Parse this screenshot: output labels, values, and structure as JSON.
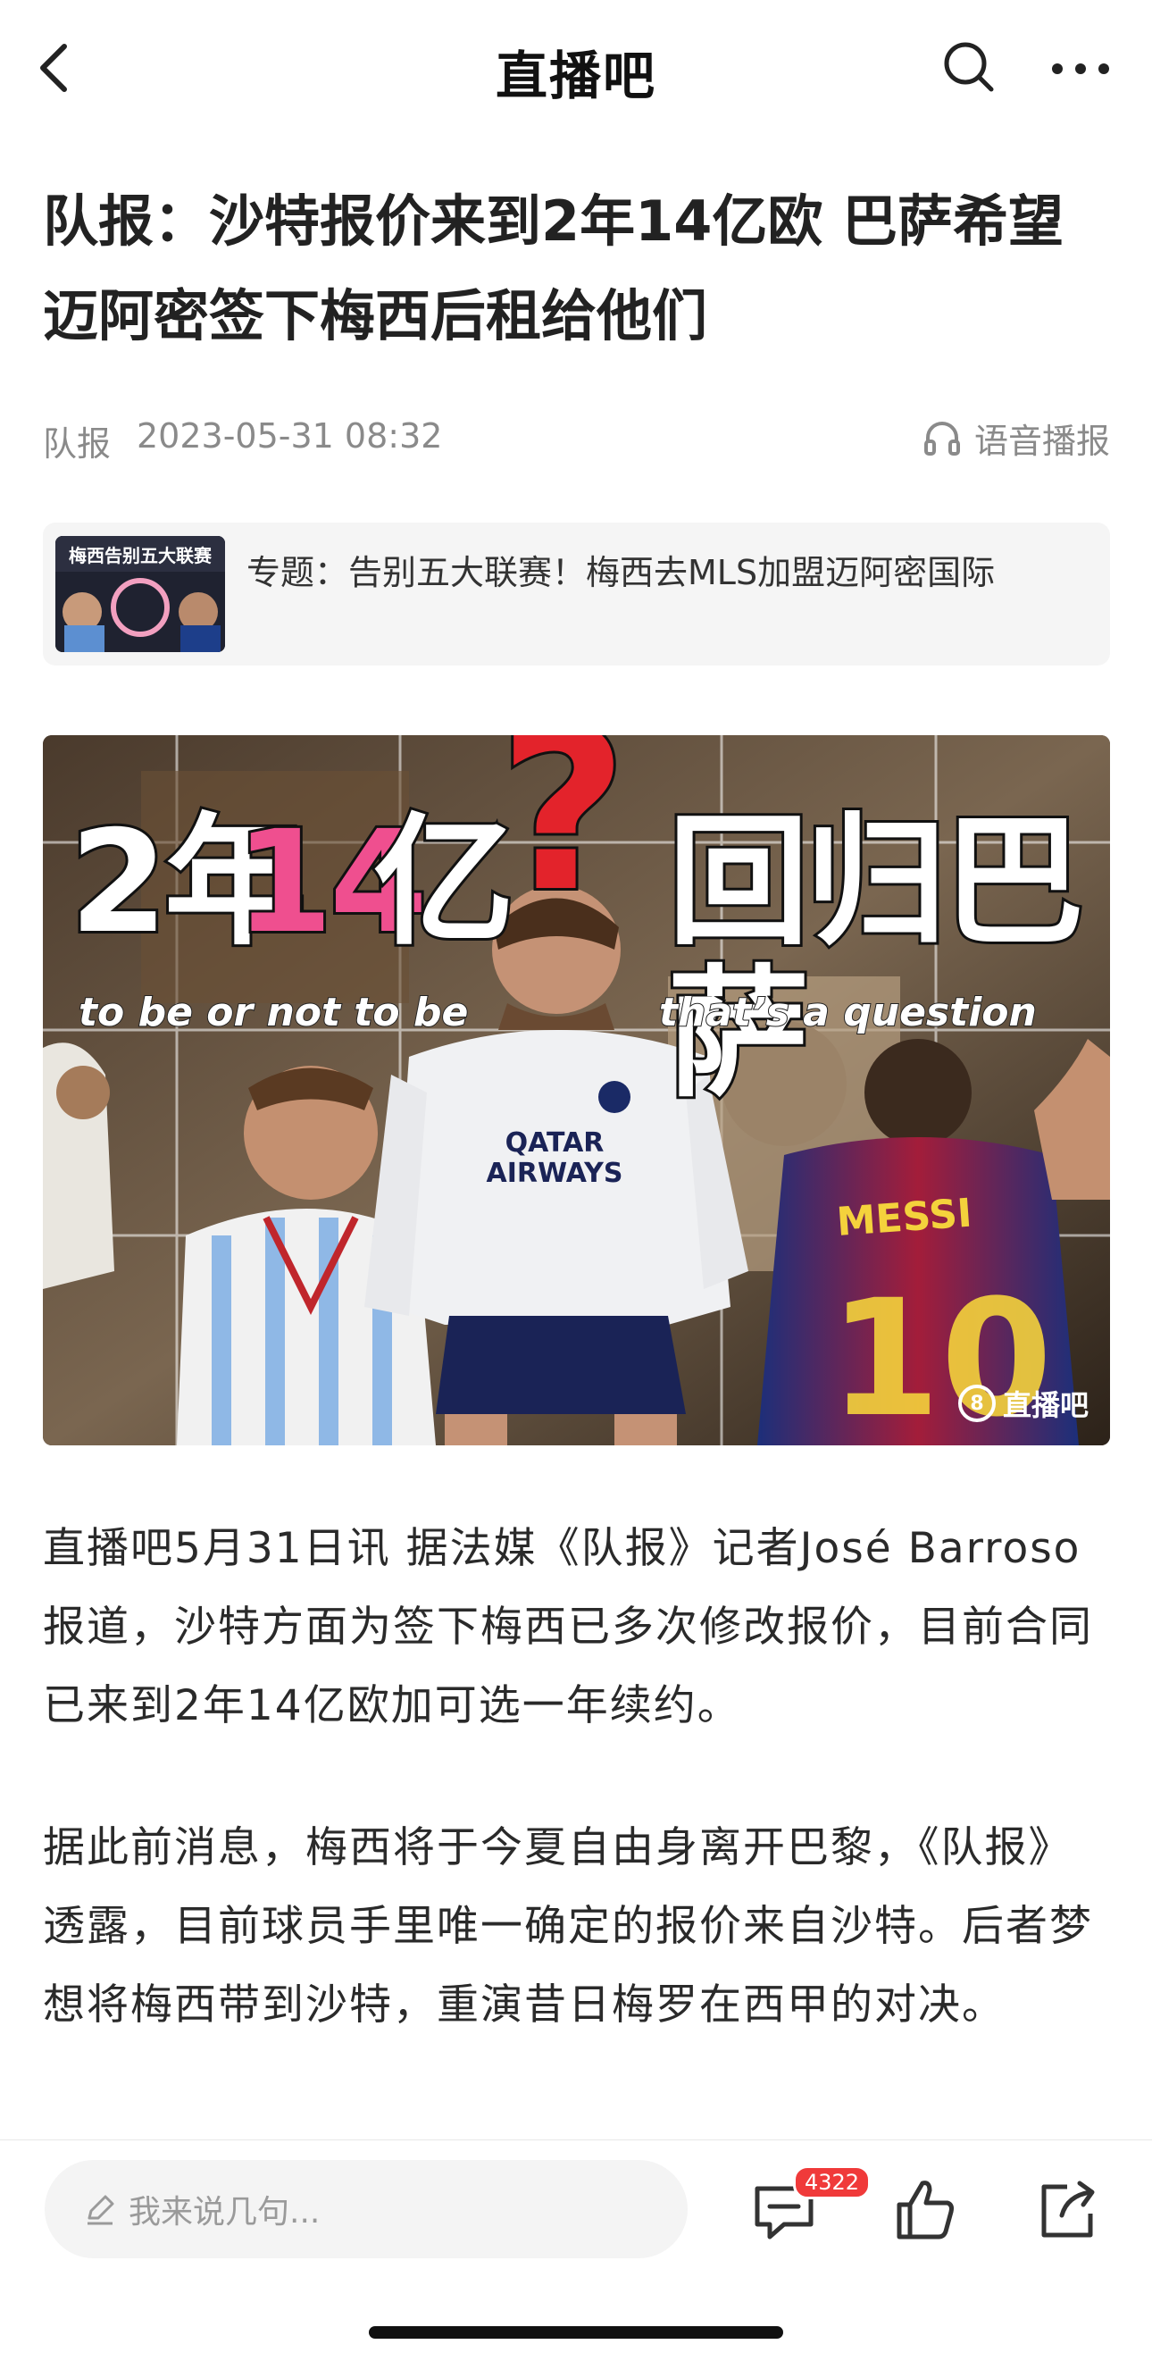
{
  "nav": {
    "title": "直播吧",
    "back_icon": "chevron-left-icon",
    "search_icon": "search-icon",
    "more_icon": "more-dots-icon"
  },
  "article": {
    "title": "队报：沙特报价来到2年14亿欧 巴萨希望迈阿密签下梅西后租给他们",
    "source": "队报",
    "datetime": "2023-05-31 08:32",
    "listen_label": "语音播报",
    "topic": {
      "text": "专题：告别五大联赛！梅西去MLS加盟迈阿密国际",
      "thumb_text": "梅西告别五大联赛"
    },
    "hero": {
      "title_part1": "2年",
      "title_part2": "14",
      "title_part3": "亿",
      "title_part4": "?",
      "title_part5": "回归巴萨",
      "subtitle_left": "to be or not to be",
      "subtitle_right": "that’s a question",
      "jersey_sponsor": "QATAR AIRWAYS",
      "back_name": "MESSI",
      "back_number": "10",
      "watermark": "直播吧"
    },
    "paragraphs": [
      "直播吧5月31日讯  据法媒《队报》记者José Barroso报道，沙特方面为签下梅西已多次修改报价，目前合同已来到2年14亿欧加可选一年续约。",
      "据此前消息，梅西将于今夏自由身离开巴黎，《队报》透露，目前球员手里唯一确定的报价来自沙特。后者梦想将梅西带到沙特，重演昔日梅罗在西甲的对决。"
    ]
  },
  "bottom_bar": {
    "comment_placeholder": "我来说几句...",
    "comment_count": "4322",
    "comment_icon": "comment-icon",
    "like_icon": "thumbs-up-icon",
    "share_icon": "share-icon"
  }
}
